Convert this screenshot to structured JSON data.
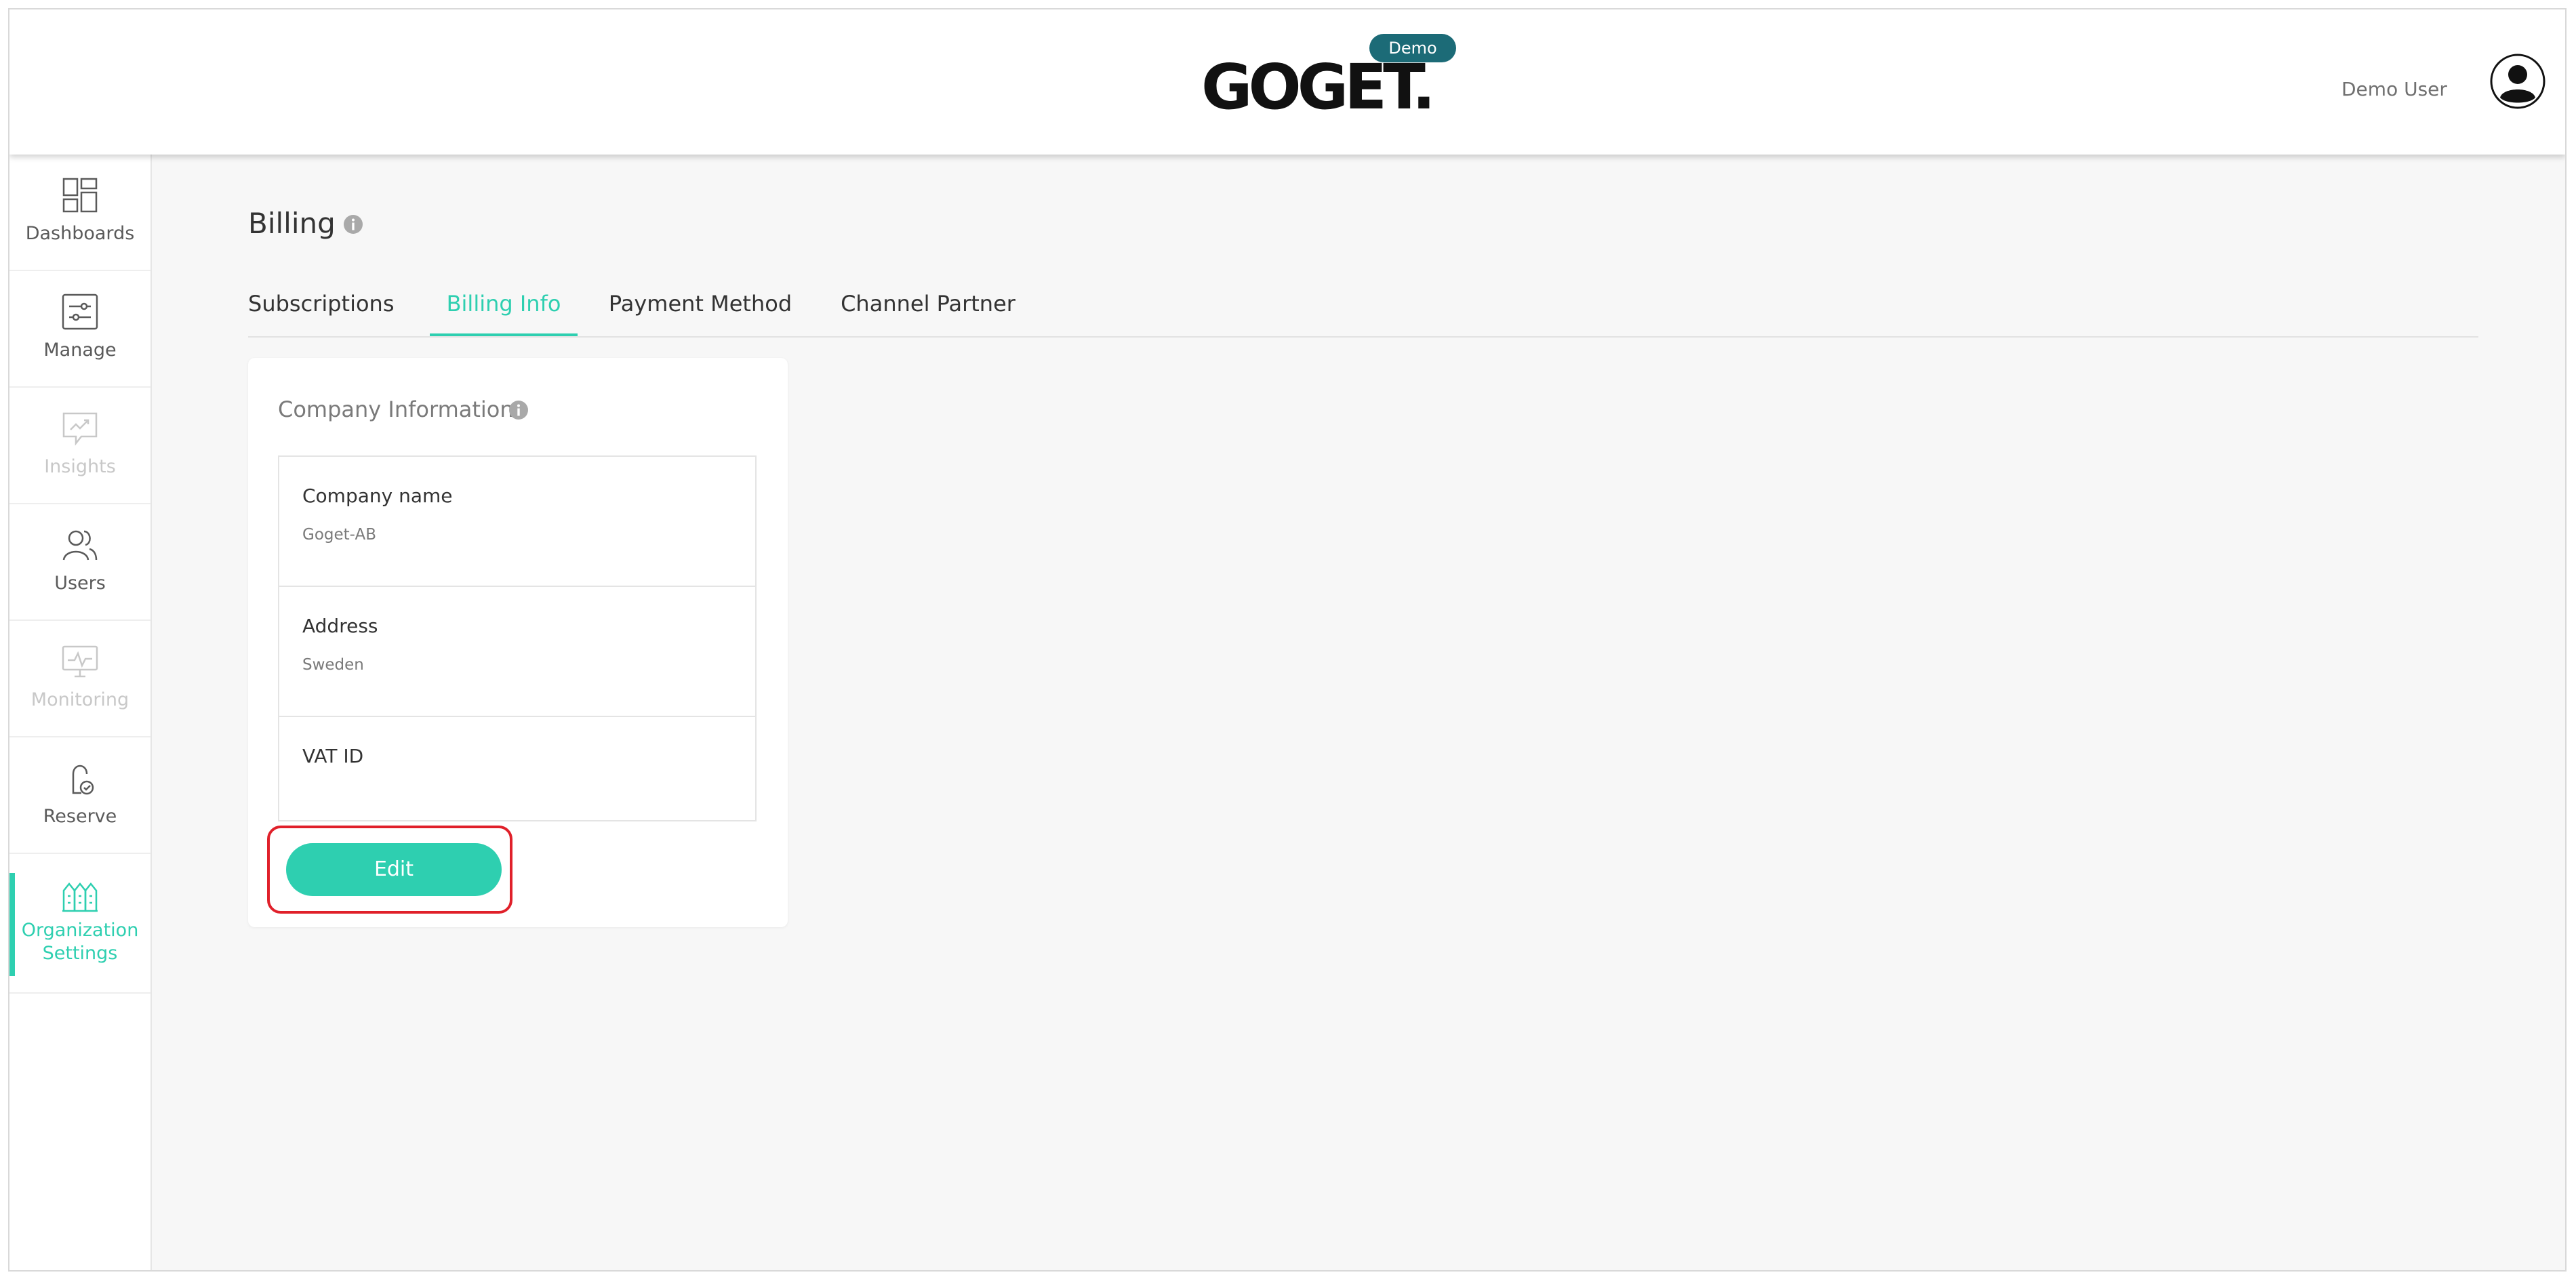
{
  "header": {
    "logo_text": "GOGET.",
    "badge": "Demo",
    "user_name": "Demo User"
  },
  "sidebar": {
    "items": [
      {
        "label": "Dashboards",
        "icon": "dashboards-icon",
        "state": "normal"
      },
      {
        "label": "Manage",
        "icon": "manage-sliders-icon",
        "state": "normal"
      },
      {
        "label": "Insights",
        "icon": "insights-flag-icon",
        "state": "disabled"
      },
      {
        "label": "Users",
        "icon": "users-icon",
        "state": "normal"
      },
      {
        "label": "Monitoring",
        "icon": "monitoring-icon",
        "state": "disabled"
      },
      {
        "label": "Reserve",
        "icon": "reserve-icon",
        "state": "normal"
      },
      {
        "label": "Organization Settings",
        "label_line1": "Organization",
        "label_line2": "Settings",
        "icon": "organization-buildings-icon",
        "state": "active"
      }
    ]
  },
  "page": {
    "title": "Billing",
    "tabs": [
      {
        "label": "Subscriptions"
      },
      {
        "label": "Billing Info",
        "active": true
      },
      {
        "label": "Payment Method"
      },
      {
        "label": "Channel Partner"
      }
    ]
  },
  "card": {
    "title": "Company Information",
    "fields": [
      {
        "label": "Company name",
        "value": "Goget-AB"
      },
      {
        "label": "Address",
        "value": "Sweden"
      },
      {
        "label": "VAT ID",
        "value": ""
      }
    ],
    "edit_label": "Edit"
  },
  "colors": {
    "accent": "#2ecfb0",
    "badge": "#1c6b77",
    "highlight": "#e0202a"
  }
}
